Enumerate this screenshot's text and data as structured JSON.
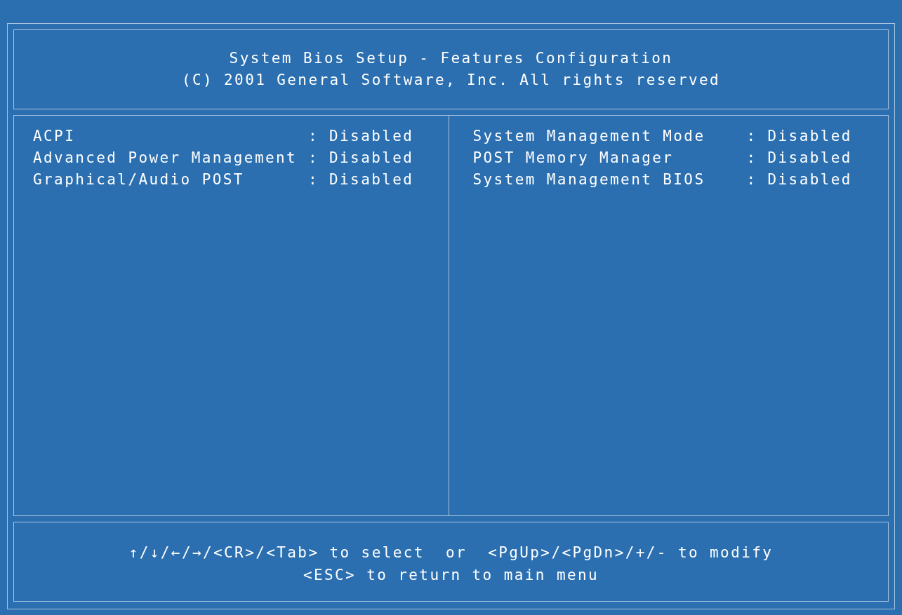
{
  "header": {
    "title": "System Bios Setup - Features Configuration",
    "copyright": "(C) 2001 General Software, Inc. All rights reserved"
  },
  "panels": [
    {
      "items": [
        {
          "label": "ACPI",
          "separator": ":",
          "value": "Disabled"
        },
        {
          "label": "Advanced Power Management",
          "separator": ":",
          "value": "Disabled"
        },
        {
          "label": "Graphical/Audio POST",
          "separator": ":",
          "value": "Disabled"
        }
      ]
    },
    {
      "items": [
        {
          "label": "System Management Mode",
          "separator": ":",
          "value": "Disabled"
        },
        {
          "label": "POST Memory Manager",
          "separator": ":",
          "value": "Disabled"
        },
        {
          "label": "System Management BIOS",
          "separator": ":",
          "value": "Disabled"
        }
      ]
    }
  ],
  "footer": {
    "lines": [
      "↑/↓/←/→/<CR>/<Tab> to select  or  <PgUp>/<PgDn>/+/- to modify",
      "<ESC> to return to main menu"
    ]
  }
}
